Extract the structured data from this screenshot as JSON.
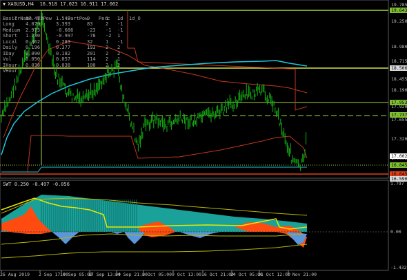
{
  "header": {
    "symbol_line": "XAGUSD,H4  16.918 17.023 16.911 17.002"
  },
  "table": {
    "columns": [
      "TrName",
      "TrPow",
      "PartPow",
      "Perc",
      "1d",
      "1d_O"
    ],
    "rows": [
      [
        "Basic",
        "17.483",
        "1.549",
        "9",
        "1",
        "1"
      ],
      [
        "Long",
        "4.079",
        "3.393",
        "83",
        "2",
        "-1"
      ],
      [
        "Medium",
        "2.973",
        "-0.686",
        "-23",
        "-1",
        "-1"
      ],
      [
        "Short",
        "1.280",
        "-0.997",
        "-78",
        "-2",
        "1"
      ],
      [
        "Local",
        "0.862",
        "0.283",
        "32",
        "1",
        "-1"
      ],
      [
        "Daily",
        "0.196",
        "0.377",
        "193",
        "2",
        "2"
      ],
      [
        "IDay",
        "0.090",
        "0.182",
        "201",
        "2",
        "2"
      ],
      [
        "Vol",
        "0.050",
        "0.057",
        "114",
        "2",
        "1"
      ],
      [
        "IHour",
        "0.038",
        "0.038",
        "100",
        "2",
        "2"
      ],
      [
        "VHour",
        "",
        "",
        "",
        "",
        ""
      ]
    ]
  },
  "price_axis": {
    "labels": [
      "19.785",
      "19.250",
      "18.980",
      "18.715",
      "18.455",
      "18.190",
      "17.920",
      "17.655",
      "17.320",
      "17.002"
    ],
    "tags": [
      {
        "text": "19.643",
        "color": "#7fbf2f"
      },
      {
        "text": "18.506",
        "color": "#d7d7d7"
      },
      {
        "text": "17.953",
        "color": "#7fbf2f"
      },
      {
        "text": "17.737",
        "color": "#7fbf2f"
      },
      {
        "text": "17.002",
        "color": "#ffffff"
      },
      {
        "text": "16.845",
        "color": "#7fbf2f"
      },
      {
        "text": "16.645",
        "color": "#e0401a"
      },
      {
        "text": "16.590",
        "color": "#d7d7d7"
      }
    ]
  },
  "oscillator": {
    "title": "SWT 0.250 -0.497 -0.056",
    "axis": [
      "1.797",
      "0.00",
      "-1.432"
    ]
  },
  "time_axis": [
    "26 Aug 2019",
    "2 Sep 17:00",
    "10 Sep 05:00",
    "17 Sep 13:00",
    "24 Sep 21:00",
    "2 Oct 05:00",
    "9 Oct 13:00",
    "16 Oct 21:00",
    "24 Oct 05:00",
    "31 Oct 12:00",
    "7 Nov 21:00"
  ],
  "colors": {
    "candles": "#13b513",
    "cyan_ma": "#1ec8e0",
    "red_line": "#c2381a",
    "level_line": "#a6d63a",
    "osc_teal": "#1aa29a",
    "osc_orange": "#ff4a10",
    "osc_blue": "#5a96dc",
    "osc_yellow": "#e8e800"
  }
}
